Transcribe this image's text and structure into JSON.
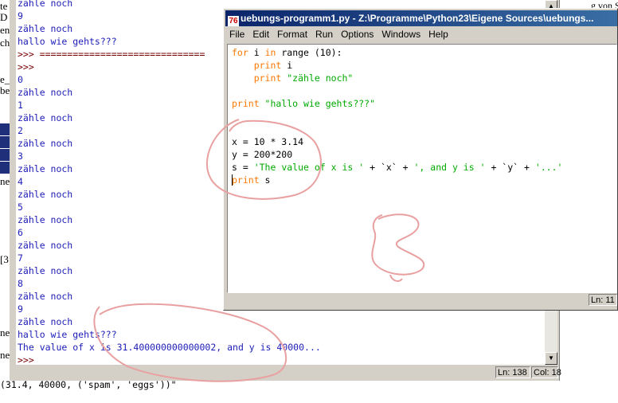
{
  "background": {
    "left_fragments": [
      "te",
      "D",
      "en",
      "ch",
      "e_",
      "be",
      "ne",
      "ne",
      "[3",
      "ne"
    ],
    "right_text": "g von String"
  },
  "shell": {
    "lines": [
      {
        "text": "zähle noch",
        "kind": "out"
      },
      {
        "text": "9",
        "kind": "out"
      },
      {
        "text": "zähle noch",
        "kind": "out"
      },
      {
        "text": "hallo wie gehts???",
        "kind": "out"
      },
      {
        "text": ">>> ==============================",
        "kind": "prompt"
      },
      {
        "text": ">>>",
        "kind": "prompt"
      },
      {
        "text": "0",
        "kind": "out"
      },
      {
        "text": "zähle noch",
        "kind": "out"
      },
      {
        "text": "1",
        "kind": "out"
      },
      {
        "text": "zähle noch",
        "kind": "out"
      },
      {
        "text": "2",
        "kind": "out"
      },
      {
        "text": "zähle noch",
        "kind": "out"
      },
      {
        "text": "3",
        "kind": "out"
      },
      {
        "text": "zähle noch",
        "kind": "out"
      },
      {
        "text": "4",
        "kind": "out"
      },
      {
        "text": "zähle noch",
        "kind": "out"
      },
      {
        "text": "5",
        "kind": "out"
      },
      {
        "text": "zähle noch",
        "kind": "out"
      },
      {
        "text": "6",
        "kind": "out"
      },
      {
        "text": "zähle noch",
        "kind": "out"
      },
      {
        "text": "7",
        "kind": "out"
      },
      {
        "text": "zähle noch",
        "kind": "out"
      },
      {
        "text": "8",
        "kind": "out"
      },
      {
        "text": "zähle noch",
        "kind": "out"
      },
      {
        "text": "9",
        "kind": "out"
      },
      {
        "text": "zähle noch",
        "kind": "out"
      },
      {
        "text": "hallo wie gehts???",
        "kind": "out"
      },
      {
        "text": "The value of x is 31.400000000000002, and y is 40000...",
        "kind": "out"
      },
      {
        "text": ">>>",
        "kind": "prompt"
      }
    ],
    "status_line": "Ln: 138",
    "status_col": "Col: 18",
    "below_text": "(31.4, 40000, ('spam', 'eggs'))\""
  },
  "editor": {
    "title": "uebungs-programm1.py - Z:\\Programme\\Python23\\Eigene Sources\\uebungs...",
    "icon_glyph": "76",
    "menu": [
      "File",
      "Edit",
      "Format",
      "Run",
      "Options",
      "Windows",
      "Help"
    ],
    "code_lines": [
      [
        {
          "t": "for",
          "c": "kw"
        },
        {
          "t": " i ",
          "c": "norm"
        },
        {
          "t": "in",
          "c": "kw"
        },
        {
          "t": " range (10):",
          "c": "norm"
        }
      ],
      [
        {
          "t": "    ",
          "c": "norm"
        },
        {
          "t": "print",
          "c": "kw"
        },
        {
          "t": " i",
          "c": "norm"
        }
      ],
      [
        {
          "t": "    ",
          "c": "norm"
        },
        {
          "t": "print",
          "c": "kw"
        },
        {
          "t": " \"zähle noch\"",
          "c": "str"
        }
      ],
      [],
      [
        {
          "t": "print",
          "c": "kw"
        },
        {
          "t": " \"hallo wie gehts???\"",
          "c": "str"
        }
      ],
      [],
      [],
      [
        {
          "t": "x = 10 * 3.14",
          "c": "norm"
        }
      ],
      [
        {
          "t": "y = 200*200",
          "c": "norm"
        }
      ],
      [
        {
          "t": "s = ",
          "c": "norm"
        },
        {
          "t": "'The value of x is '",
          "c": "str"
        },
        {
          "t": " + `x` + ",
          "c": "norm"
        },
        {
          "t": "', and y is '",
          "c": "str"
        },
        {
          "t": " + `y` + ",
          "c": "norm"
        },
        {
          "t": "'...'",
          "c": "str"
        }
      ],
      [
        {
          "t": "print",
          "c": "kw"
        },
        {
          "t": " s",
          "c": "norm"
        }
      ]
    ],
    "status_line": "Ln: 11"
  },
  "colors": {
    "keyword": "#ff7700",
    "string": "#00aa00",
    "shell_output": "#1c1cb8",
    "title_bar": "#0a246a",
    "annotation": "#e8a0a0"
  }
}
